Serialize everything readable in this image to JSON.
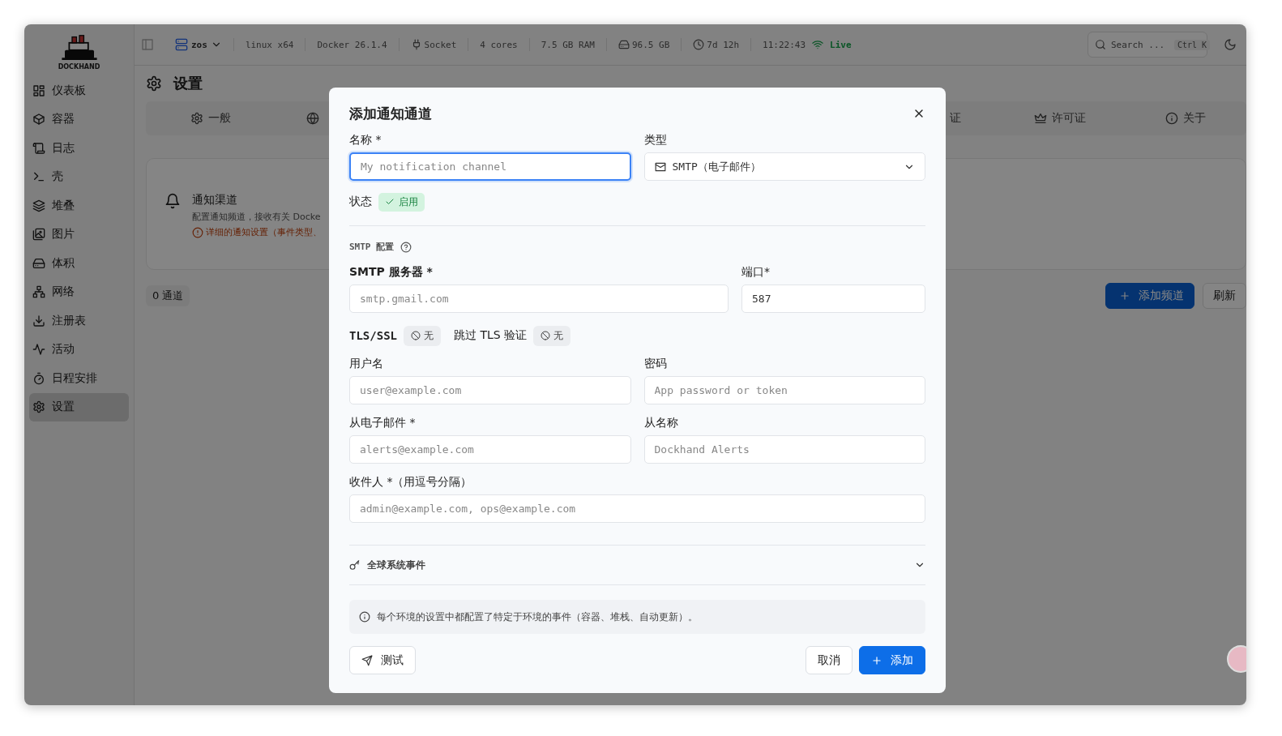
{
  "app": {
    "logo": "DOCKHAND"
  },
  "topbar": {
    "environment": "zos",
    "stats": [
      {
        "kind": "text",
        "text": "linux x64"
      },
      {
        "kind": "text",
        "text": "Docker 26.1.4"
      },
      {
        "kind": "socket",
        "text": "Socket"
      },
      {
        "kind": "text",
        "text": "4 cores"
      },
      {
        "kind": "text",
        "text": "7.5 GB RAM"
      },
      {
        "kind": "drive",
        "text": "96.5 GB"
      },
      {
        "kind": "uptime",
        "text": "7d 12h"
      }
    ],
    "time": "11:22:43",
    "live": "Live",
    "search": {
      "placeholder": "Search ...",
      "shortcut": "Ctrl K"
    }
  },
  "sidebar": {
    "items": [
      {
        "label": "仪表板",
        "selected": false
      },
      {
        "label": "容器",
        "selected": false
      },
      {
        "label": "日志",
        "selected": false
      },
      {
        "label": "壳",
        "selected": false
      },
      {
        "label": "堆叠",
        "selected": false
      },
      {
        "label": "图片",
        "selected": false
      },
      {
        "label": "体积",
        "selected": false
      },
      {
        "label": "网络",
        "selected": false
      },
      {
        "label": "注册表",
        "selected": false
      },
      {
        "label": "活动",
        "selected": false
      },
      {
        "label": "日程安排",
        "selected": false
      },
      {
        "label": "设置",
        "selected": true
      }
    ]
  },
  "page": {
    "title": "设置",
    "tabs": [
      {
        "label": "一般"
      },
      {
        "label": "证"
      },
      {
        "label": "许可证"
      },
      {
        "label": "关于"
      }
    ],
    "card": {
      "title": "通知渠道",
      "description": "配置通知频道，接收有关 Docke",
      "note": "详细的通知设置（事件类型、"
    },
    "count": "0 通道",
    "add_button": "添加频道",
    "refresh_button": "刷新"
  },
  "dialog": {
    "title": "添加通知通道",
    "name": {
      "label": "名称 *",
      "placeholder": "My notification channel"
    },
    "type": {
      "label": "类型",
      "value": "SMTP（电子邮件）"
    },
    "status": {
      "label": "状态",
      "badge": "启用",
      "enabled": true
    },
    "section": "SMTP 配置",
    "server": {
      "label": "SMTP 服务器 *",
      "placeholder": "smtp.gmail.com"
    },
    "port": {
      "label": "端口*",
      "value": "587"
    },
    "tls": {
      "label": "TLS/SSL",
      "value": "无"
    },
    "skip_verify": {
      "label": "跳过 TLS 验证",
      "value": "无"
    },
    "username": {
      "label": "用户名",
      "placeholder": "user@example.com"
    },
    "password": {
      "label": "密码",
      "placeholder": "App password or token"
    },
    "from_email": {
      "label": "从电子邮件 *",
      "placeholder": "alerts@example.com"
    },
    "from_name": {
      "label": "从名称",
      "placeholder": "Dockhand Alerts"
    },
    "recipients": {
      "label": "收件人 *（用逗号分隔）",
      "placeholder": "admin@example.com, ops@example.com"
    },
    "events": {
      "label": "全球系统事件",
      "expanded": false
    },
    "info": "每个环境的设置中都配置了特定于环境的事件（容器、堆栈、自动更新）。",
    "test_button": "测试",
    "cancel_button": "取消",
    "add_button": "添加"
  }
}
